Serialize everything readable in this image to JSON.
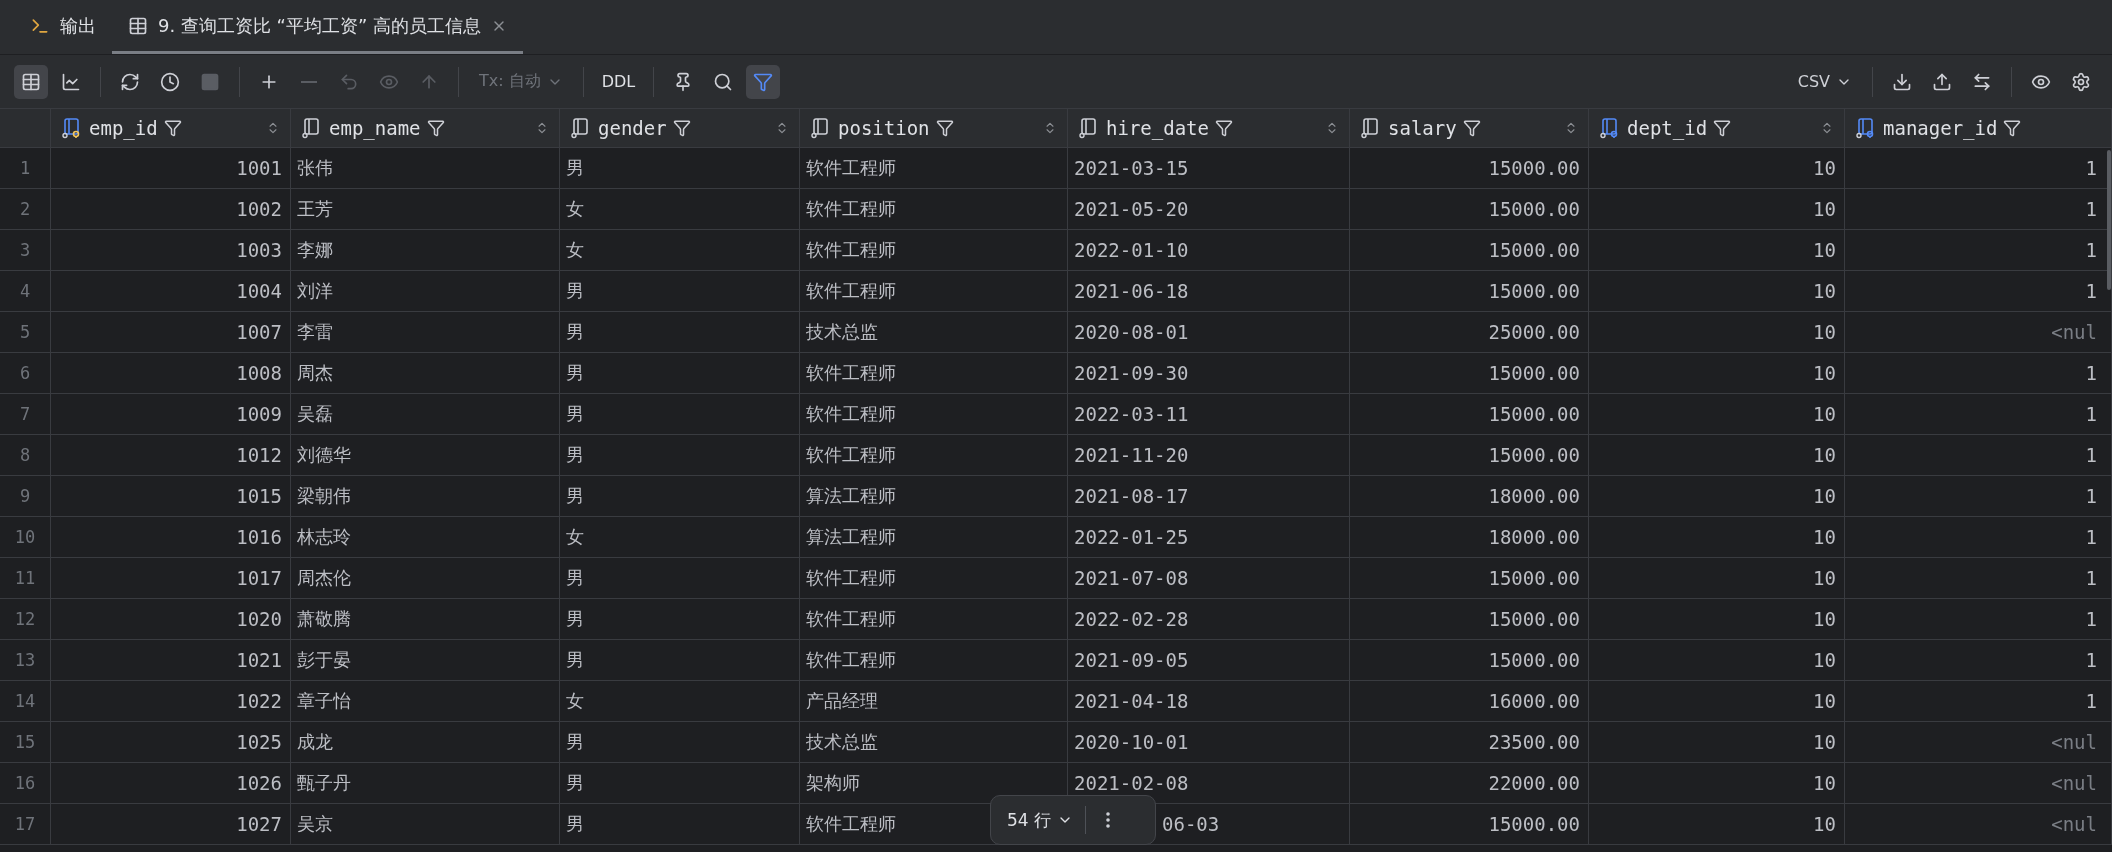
{
  "tabs": [
    {
      "label": "输出",
      "kind": "output",
      "selected": false
    },
    {
      "label": "9. 查询工资比 “平均工资” 高的员工信息",
      "kind": "table",
      "selected": true
    }
  ],
  "toolbar": {
    "view_modes": [
      {
        "selected": true
      },
      {
        "selected": false
      }
    ],
    "actions": [
      {
        "disabled": false
      },
      {
        "disabled": false
      },
      {
        "disabled": true
      },
      {
        "disabled": false
      },
      {
        "disabled": true
      },
      {
        "disabled": true
      },
      {
        "disabled": true
      },
      {
        "disabled": true
      }
    ],
    "transaction": {
      "label": "Tx: 自动",
      "disabled": true
    },
    "ddl": "DDL",
    "filter_on": true,
    "export_format": "CSV"
  },
  "table": {
    "columns": [
      {
        "name": "emp_id",
        "kind": "primary"
      },
      {
        "name": "emp_name",
        "kind": "text"
      },
      {
        "name": "gender",
        "kind": "text"
      },
      {
        "name": "position",
        "kind": "text"
      },
      {
        "name": "hire_date",
        "kind": "text"
      },
      {
        "name": "salary",
        "kind": "number"
      },
      {
        "name": "dept_id",
        "kind": "foreign"
      },
      {
        "name": "manager_id",
        "kind": "foreign"
      }
    ],
    "rows": [
      {
        "num": "1",
        "cells": [
          "1001",
          "张伟",
          "男",
          "软件工程师",
          "2021-03-15",
          "15000.00",
          "10",
          "1"
        ]
      },
      {
        "num": "2",
        "cells": [
          "1002",
          "王芳",
          "女",
          "软件工程师",
          "2021-05-20",
          "15000.00",
          "10",
          "1"
        ]
      },
      {
        "num": "3",
        "cells": [
          "1003",
          "李娜",
          "女",
          "软件工程师",
          "2022-01-10",
          "15000.00",
          "10",
          "1"
        ]
      },
      {
        "num": "4",
        "cells": [
          "1004",
          "刘洋",
          "男",
          "软件工程师",
          "2021-06-18",
          "15000.00",
          "10",
          "1"
        ]
      },
      {
        "num": "5",
        "cells": [
          "1007",
          "李雷",
          "男",
          "技术总监",
          "2020-08-01",
          "25000.00",
          "10",
          {
            "value": "<nul",
            "is_null": true
          }
        ]
      },
      {
        "num": "6",
        "cells": [
          "1008",
          "周杰",
          "男",
          "软件工程师",
          "2021-09-30",
          "15000.00",
          "10",
          "1"
        ]
      },
      {
        "num": "7",
        "cells": [
          "1009",
          "吴磊",
          "男",
          "软件工程师",
          "2022-03-11",
          "15000.00",
          "10",
          "1"
        ]
      },
      {
        "num": "8",
        "cells": [
          "1012",
          "刘德华",
          "男",
          "软件工程师",
          "2021-11-20",
          "15000.00",
          "10",
          "1"
        ]
      },
      {
        "num": "9",
        "cells": [
          "1015",
          "梁朝伟",
          "男",
          "算法工程师",
          "2021-08-17",
          "18000.00",
          "10",
          "1"
        ]
      },
      {
        "num": "10",
        "cells": [
          "1016",
          "林志玲",
          "女",
          "算法工程师",
          "2022-01-25",
          "18000.00",
          "10",
          "1"
        ]
      },
      {
        "num": "11",
        "cells": [
          "1017",
          "周杰伦",
          "男",
          "软件工程师",
          "2021-07-08",
          "15000.00",
          "10",
          "1"
        ]
      },
      {
        "num": "12",
        "cells": [
          "1020",
          "萧敬腾",
          "男",
          "软件工程师",
          "2022-02-28",
          "15000.00",
          "10",
          "1"
        ]
      },
      {
        "num": "13",
        "cells": [
          "1021",
          "彭于晏",
          "男",
          "软件工程师",
          "2021-09-05",
          "15000.00",
          "10",
          "1"
        ]
      },
      {
        "num": "14",
        "cells": [
          "1022",
          "章子怡",
          "女",
          "产品经理",
          "2021-04-18",
          "16000.00",
          "10",
          "1"
        ]
      },
      {
        "num": "15",
        "cells": [
          "1025",
          "成龙",
          "男",
          "技术总监",
          "2020-10-01",
          "23500.00",
          "10",
          {
            "value": "<nul",
            "is_null": true
          }
        ]
      },
      {
        "num": "16",
        "cells": [
          "1026",
          "甄子丹",
          "男",
          "架构师",
          "2021-02-08",
          "22000.00",
          "10",
          {
            "value": "<nul",
            "is_null": true
          }
        ]
      },
      {
        "num": "17",
        "cells": [
          "1027",
          "吴京",
          "男",
          "软件工程师",
          {
            "value": "06-03",
            "covered": true
          },
          "15000.00",
          "10",
          {
            "value": "<nul",
            "is_null": true
          }
        ]
      }
    ]
  },
  "pager": {
    "row_count": "54 行"
  }
}
